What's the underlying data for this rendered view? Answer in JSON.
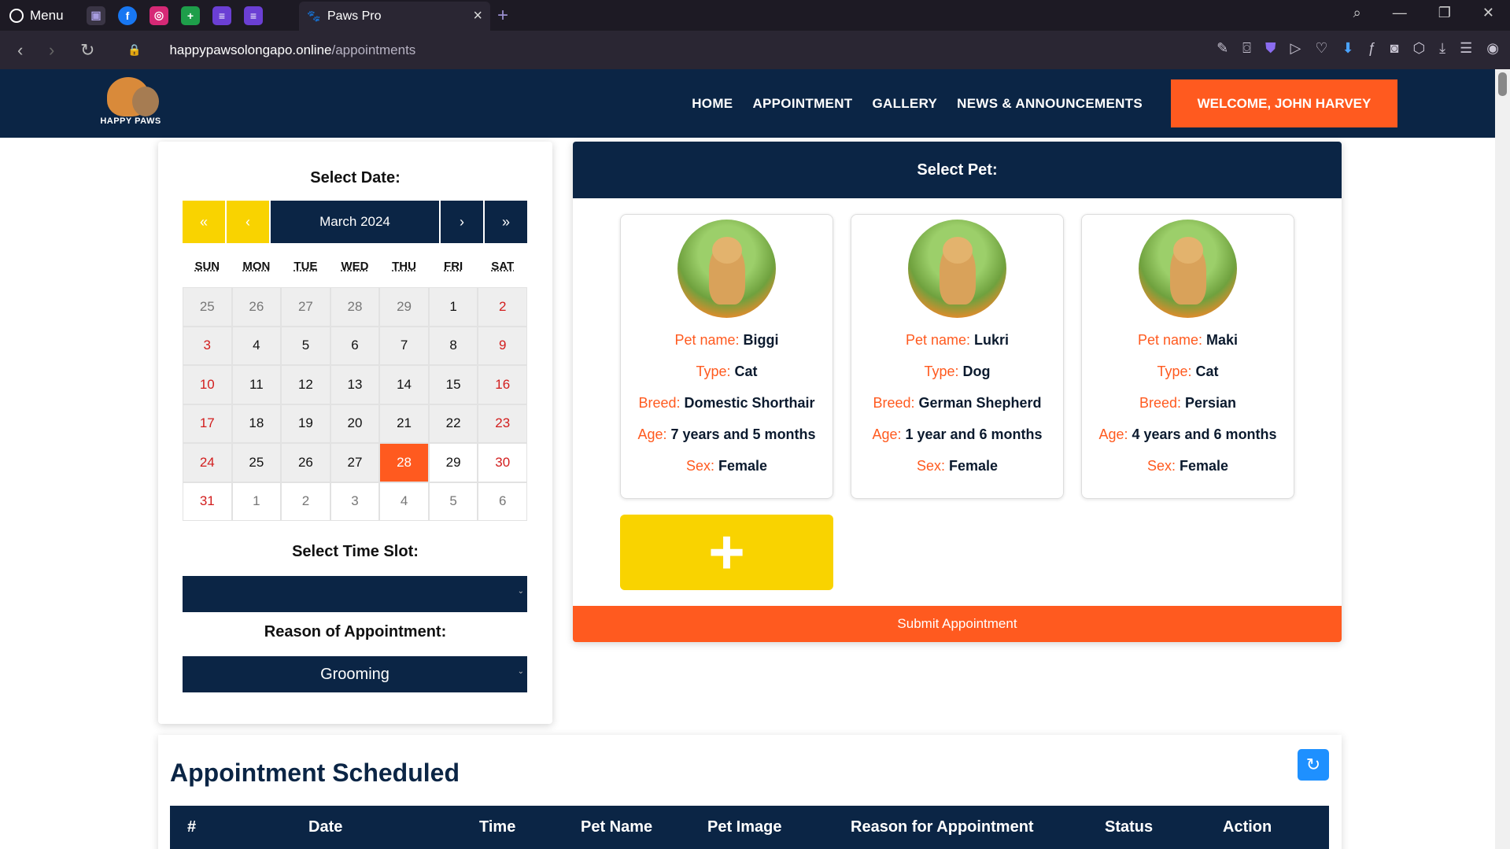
{
  "browser": {
    "menu_label": "Menu",
    "tab_title": "Paws Pro",
    "url_host": "happypawsolongapo.online",
    "url_path": "/appointments"
  },
  "site": {
    "logo_text": "HAPPY PAWS",
    "nav": [
      "HOME",
      "APPOINTMENT",
      "GALLERY",
      "NEWS & ANNOUNCEMENTS"
    ],
    "welcome": "WELCOME, JOHN HARVEY"
  },
  "calendar": {
    "title": "Select Date:",
    "first_label": "«",
    "prev_label": "‹",
    "month": "March 2024",
    "next_label": "›",
    "last_label": "»",
    "days_of_week": [
      "SUN",
      "MON",
      "TUE",
      "WED",
      "THU",
      "FRI",
      "SAT"
    ],
    "days": [
      [
        "25",
        "26",
        "27",
        "28",
        "29",
        "1",
        "2"
      ],
      [
        "3",
        "4",
        "5",
        "6",
        "7",
        "8",
        "9"
      ],
      [
        "10",
        "11",
        "12",
        "13",
        "14",
        "15",
        "16"
      ],
      [
        "17",
        "18",
        "19",
        "20",
        "21",
        "22",
        "23"
      ],
      [
        "24",
        "25",
        "26",
        "27",
        "28",
        "29",
        "30"
      ],
      [
        "31",
        "1",
        "2",
        "3",
        "4",
        "5",
        "6"
      ]
    ],
    "selected": "28"
  },
  "time_slot": {
    "title": "Select Time Slot:",
    "value": ""
  },
  "reason": {
    "title": "Reason of Appointment:",
    "value": "Grooming"
  },
  "pets": {
    "title": "Select Pet:",
    "labels": {
      "name": "Pet name:",
      "type": "Type:",
      "breed": "Breed:",
      "age": "Age:",
      "sex": "Sex:"
    },
    "items": [
      {
        "name": "Biggi",
        "type": "Cat",
        "breed": "Domestic Shorthair",
        "age": "7 years and 5 months",
        "sex": "Female"
      },
      {
        "name": "Lukri",
        "type": "Dog",
        "breed": "German Shepherd",
        "age": "1 year and 6 months",
        "sex": "Female"
      },
      {
        "name": "Maki",
        "type": "Cat",
        "breed": "Persian",
        "age": "4 years and 6 months",
        "sex": "Female"
      }
    ],
    "add_label": "+",
    "submit_label": "Submit Appointment"
  },
  "appointments": {
    "title": "Appointment Scheduled",
    "columns": [
      "#",
      "Date",
      "Time",
      "Pet Name",
      "Pet Image",
      "Reason for Appointment",
      "Status",
      "Action"
    ]
  },
  "colors": {
    "navy": "#0b2545",
    "orange": "#ff5a1f",
    "yellow": "#f9d300"
  }
}
